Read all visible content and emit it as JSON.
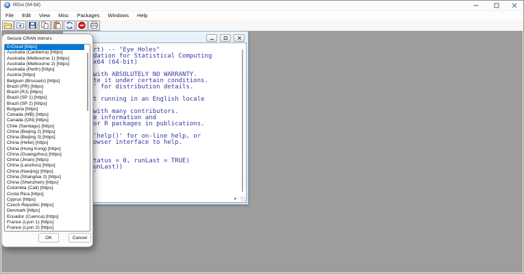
{
  "window": {
    "title": "RGui (64-bit)"
  },
  "menu": {
    "items": [
      "File",
      "Edit",
      "View",
      "Misc",
      "Packages",
      "Windows",
      "Help"
    ]
  },
  "toolbar": {
    "buttons": [
      "open-script",
      "load-workspace",
      "save-workspace",
      "copy",
      "paste",
      "copy-and-paste",
      "stop-computation",
      "print"
    ]
  },
  "console": {
    "text_color": "#3636a2",
    "visible_lines": [
      {
        "row": 0,
        "text": "rt) -- \"Eye Holes\""
      },
      {
        "row": 1,
        "text": "dation for Statistical Computing"
      },
      {
        "row": 2,
        "text": "x64 (64-bit)"
      },
      {
        "row": 4,
        "text": "with ABSOLUTELY NO WARRANTY."
      },
      {
        "row": 5,
        "text": "te it under certain conditions."
      },
      {
        "row": 6,
        "text": "' for distribution details."
      },
      {
        "row": 8,
        "text": "t running in an English locale"
      },
      {
        "row": 10,
        "text": "with many contributors."
      },
      {
        "row": 11,
        "text": "e information and"
      },
      {
        "row": 12,
        "text": "or R packages in publications."
      },
      {
        "row": 14,
        "text": "'help()' for on-line help, or"
      },
      {
        "row": 15,
        "text": "owser interface to help."
      },
      {
        "row": 18,
        "text": "tatus = 0, runLast = TRUE)"
      },
      {
        "row": 19,
        "text": "unLast))"
      },
      {
        "row": 20,
        "text": "'"
      }
    ]
  },
  "dialog": {
    "title": "Secure CRAN mirrors",
    "selected_index": 0,
    "selection_color": "#0078d7",
    "items": [
      "0-Cloud [https]",
      "Australia (Canberra) [https]",
      "Australia (Melbourne 1) [https]",
      "Australia (Melbourne 2) [https]",
      "Australia (Perth) [https]",
      "Austria [https]",
      "Belgium (Brussels) [https]",
      "Brazil (PR) [https]",
      "Brazil (RJ) [https]",
      "Brazil (SP 1) [https]",
      "Brazil (SP 2) [https]",
      "Bulgaria [https]",
      "Canada (MB) [https]",
      "Canada (ON) [https]",
      "Chile (Santiago) [https]",
      "China (Beijing 2) [https]",
      "China (Beijing 3) [https]",
      "China (Hefei) [https]",
      "China (Hong Kong) [https]",
      "China (Guangzhou) [https]",
      "China (Jinan) [https]",
      "China (Lanzhou) [https]",
      "China (Nanjing) [https]",
      "China (Shanghai 2) [https]",
      "China (Shenzhen) [https]",
      "Colombia (Cali) [https]",
      "Costa Rica [https]",
      "Cyprus [https]",
      "Czech Republic [https]",
      "Denmark [https]",
      "Ecuador (Cuenca) [https]",
      "France (Lyon 1) [https]",
      "France (Lyon 2) [https]"
    ],
    "buttons": {
      "ok": "OK",
      "cancel": "Cancel"
    }
  },
  "colors": {
    "mdi_background": "#9d9d9d",
    "accent": "#0078d7"
  }
}
